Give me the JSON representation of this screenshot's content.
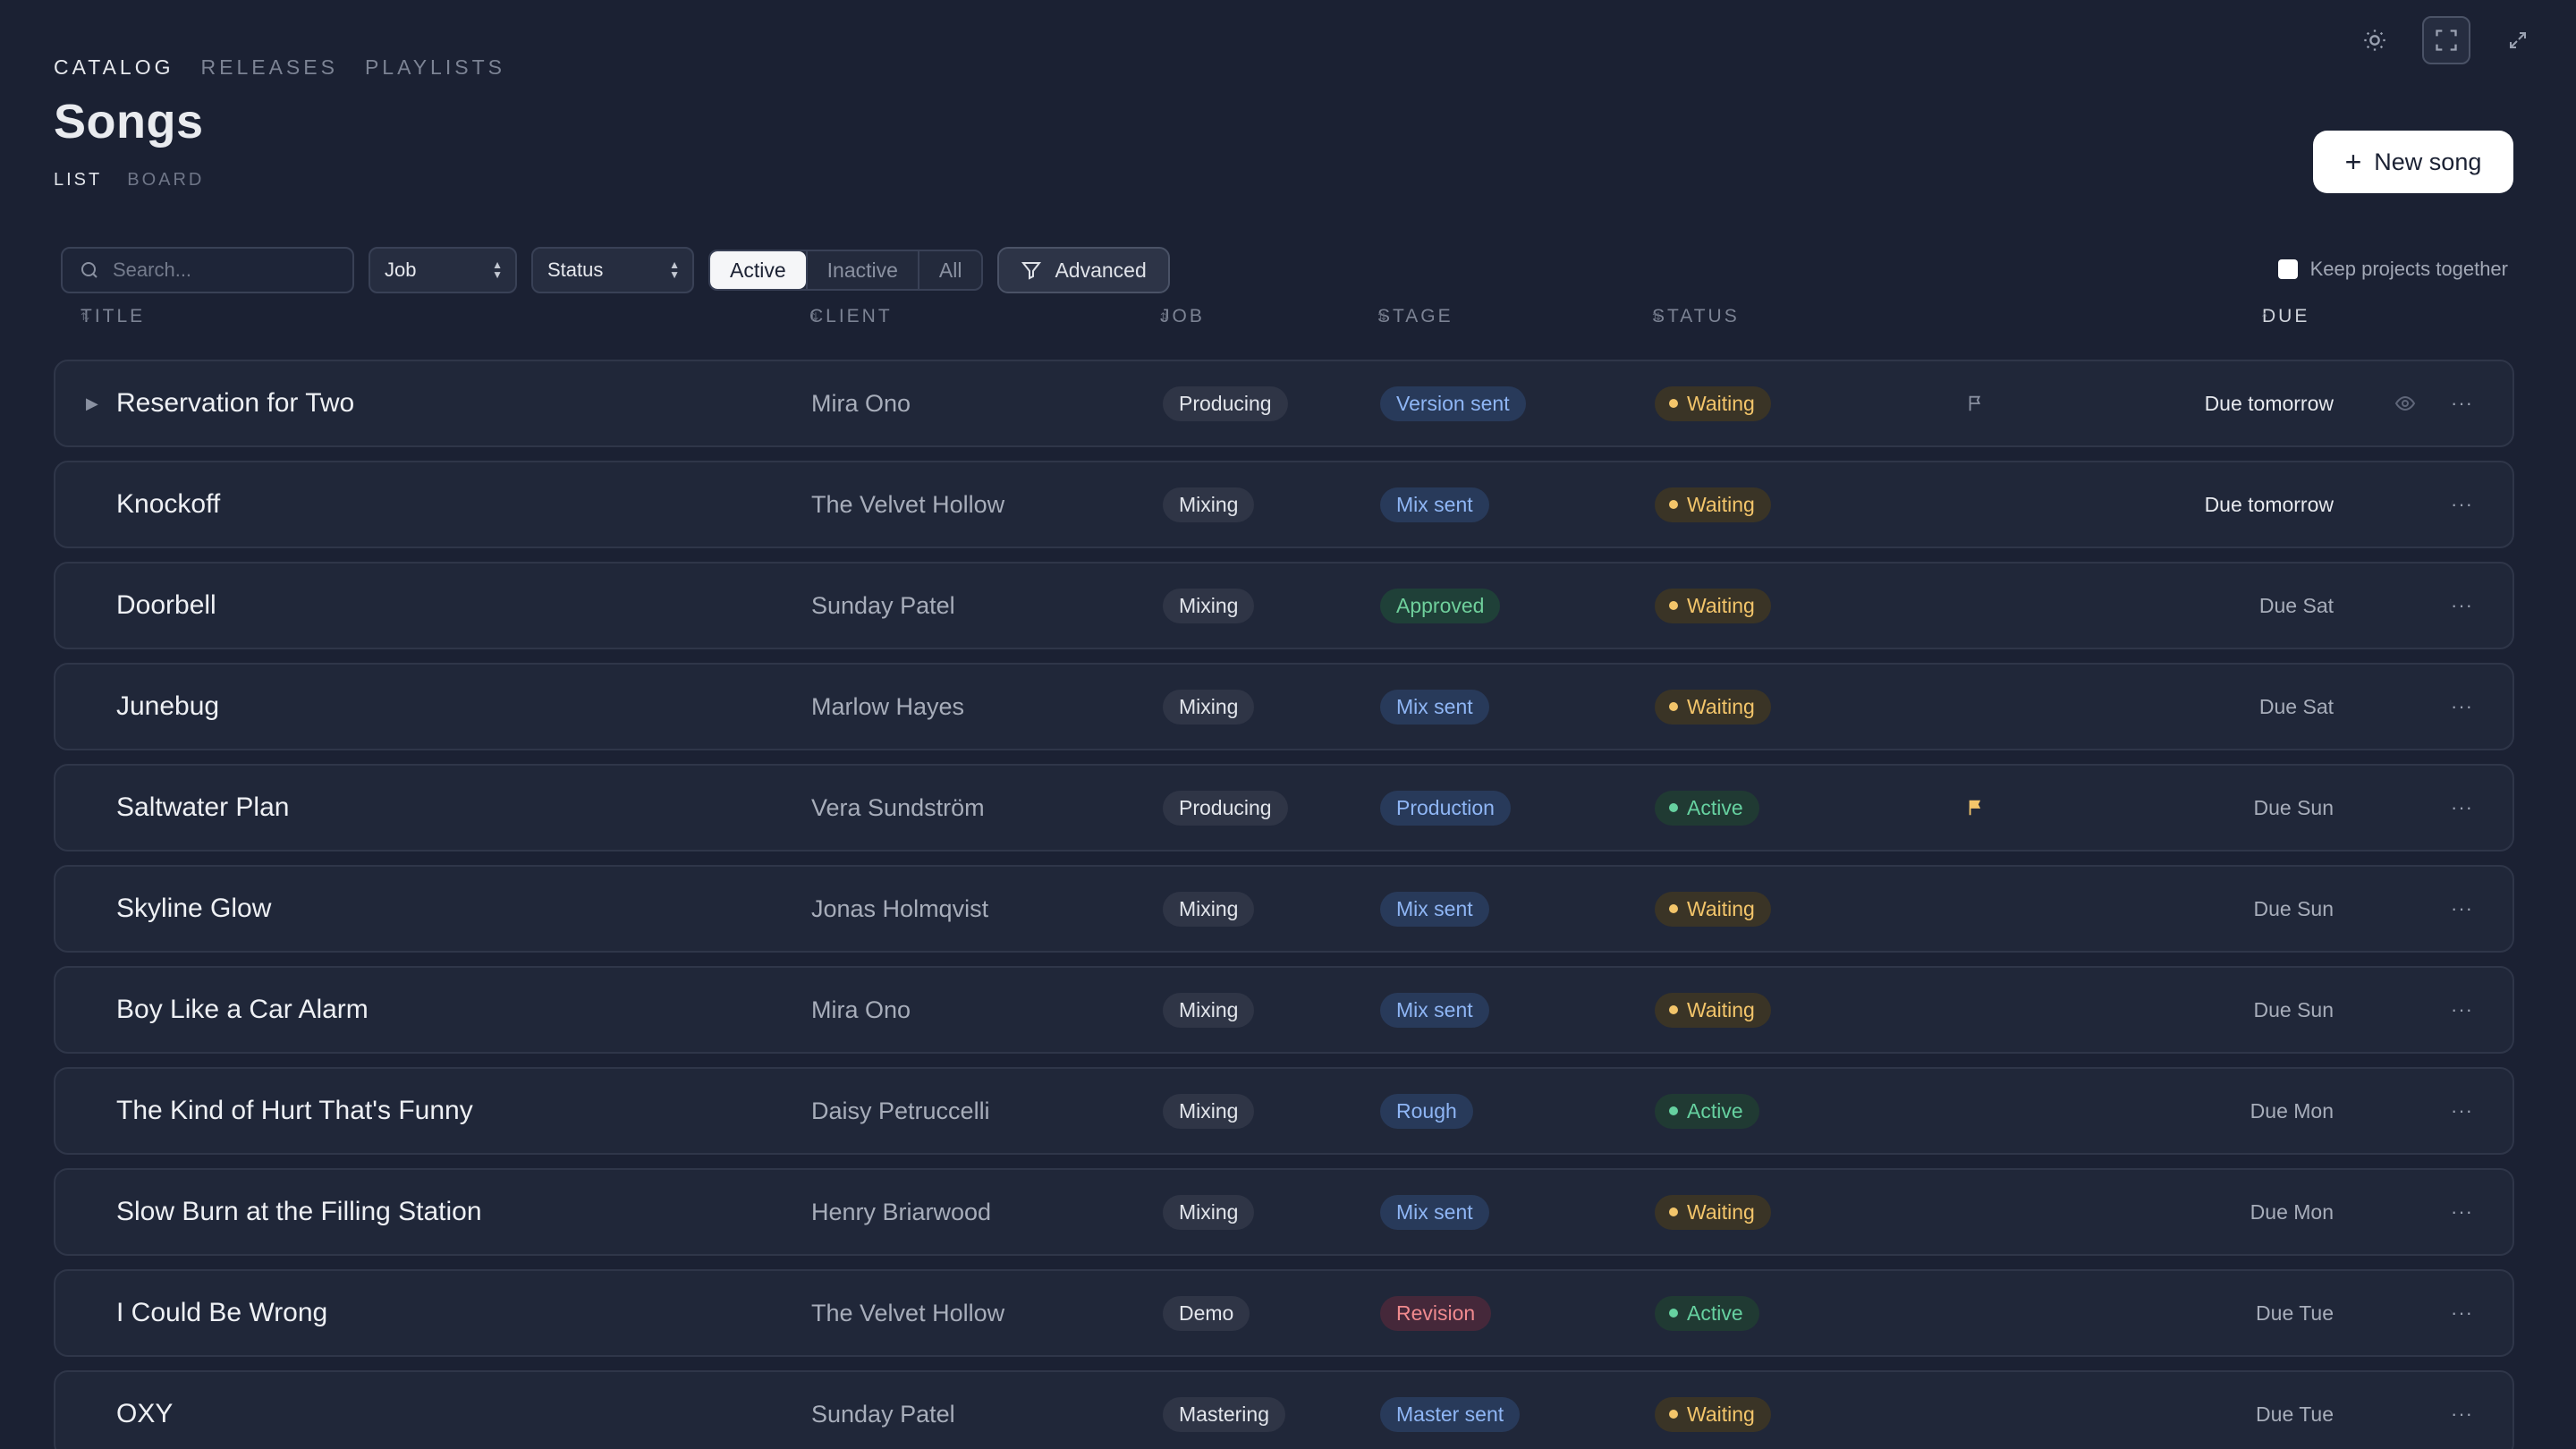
{
  "nav": {
    "tabs": [
      "CATALOG",
      "RELEASES",
      "PLAYLISTS"
    ]
  },
  "page": {
    "title": "Songs"
  },
  "view_tabs": [
    "LIST",
    "BOARD"
  ],
  "new_button": {
    "label": "New song"
  },
  "filters": {
    "search_placeholder": "Search...",
    "job_select": "Job",
    "status_select": "Status",
    "segments": [
      "Active",
      "Inactive",
      "All"
    ],
    "advanced_label": "Advanced",
    "keep_together_label": "Keep projects together"
  },
  "columns": [
    "TITLE",
    "CLIENT",
    "JOB",
    "STAGE",
    "STATUS",
    "DUE"
  ],
  "rows": [
    {
      "title": "Reservation for Two",
      "client": "Mira Ono",
      "job": "Producing",
      "stage": "Version sent",
      "status": "Waiting",
      "due": "Due tomorrow"
    },
    {
      "title": "Knockoff",
      "client": "The Velvet Hollow",
      "job": "Mixing",
      "stage": "Mix sent",
      "status": "Waiting",
      "due": "Due tomorrow"
    },
    {
      "title": "Doorbell",
      "client": "Sunday Patel",
      "job": "Mixing",
      "stage": "Approved",
      "status": "Waiting",
      "due": "Due Sat"
    },
    {
      "title": "Junebug",
      "client": "Marlow Hayes",
      "job": "Mixing",
      "stage": "Mix sent",
      "status": "Waiting",
      "due": "Due Sat"
    },
    {
      "title": "Saltwater Plan",
      "client": "Vera Sundström",
      "job": "Producing",
      "stage": "Production",
      "status": "Active",
      "due": "Due Sun"
    },
    {
      "title": "Skyline Glow",
      "client": "Jonas Holmqvist",
      "job": "Mixing",
      "stage": "Mix sent",
      "status": "Waiting",
      "due": "Due Sun"
    },
    {
      "title": "Boy Like a Car Alarm",
      "client": "Mira Ono",
      "job": "Mixing",
      "stage": "Mix sent",
      "status": "Waiting",
      "due": "Due Sun"
    },
    {
      "title": "The Kind of Hurt That's Funny",
      "client": "Daisy Petruccelli",
      "job": "Mixing",
      "stage": "Rough",
      "status": "Active",
      "due": "Due Mon"
    },
    {
      "title": "Slow Burn at the Filling Station",
      "client": "Henry Briarwood",
      "job": "Mixing",
      "stage": "Mix sent",
      "status": "Waiting",
      "due": "Due Mon"
    },
    {
      "title": "I Could Be Wrong",
      "client": "The Velvet Hollow",
      "job": "Demo",
      "stage": "Revision",
      "status": "Active",
      "due": "Due Tue"
    },
    {
      "title": "OXY",
      "client": "Sunday Patel",
      "job": "Mastering",
      "stage": "Master sent",
      "status": "Waiting",
      "due": "Due Tue"
    }
  ],
  "colors": {
    "background": "#1b2133",
    "waiting": "#f3c56a",
    "active": "#66d1a0",
    "stage_blue": "#8fb6f5",
    "flag": "#f3c56a"
  }
}
